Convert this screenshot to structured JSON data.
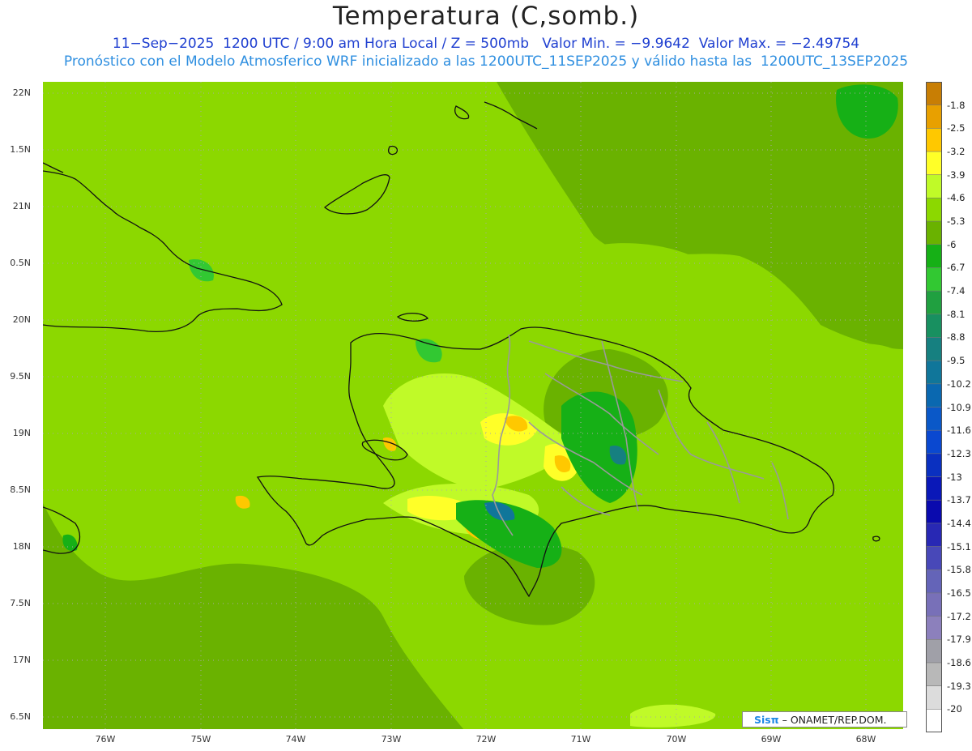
{
  "title": "Temperatura (C,somb.)",
  "subtitle_line1": "11−Sep−2025  1200 UTC / 9:00 am Hora Local / Z = 500mb   Valor Min. = −9.9642  Valor Max. = −2.49754",
  "subtitle_line2": "Pronóstico con el Modelo Atmosferico WRF inicializado a las 1200UTC_11SEP2025 y válido hasta las  1200UTC_13SEP2025",
  "lat_labels": [
    "22N",
    "1.5N",
    "21N",
    "0.5N",
    "20N",
    "9.5N",
    "19N",
    "8.5N",
    "18N",
    "7.5N",
    "17N",
    "6.5N"
  ],
  "lon_labels": [
    "76W",
    "75W",
    "74W",
    "73W",
    "72W",
    "71W",
    "70W",
    "69W",
    "68W"
  ],
  "colorbar": {
    "labels": [
      "-1.8",
      "-2.5",
      "-3.2",
      "-3.9",
      "-4.6",
      "-5.3",
      "-6",
      "-6.7",
      "-7.4",
      "-8.1",
      "-8.8",
      "-9.5",
      "-10.2",
      "-10.9",
      "-11.6",
      "-12.3",
      "-13",
      "-13.7",
      "-14.4",
      "-15.1",
      "-15.8",
      "-16.5",
      "-17.2",
      "-17.9",
      "-18.6",
      "-19.3",
      "-20"
    ],
    "colors": [
      "#c87e04",
      "#e8a000",
      "#ffc800",
      "#ffff28",
      "#c0fa28",
      "#8cd800",
      "#6ab200",
      "#16b016",
      "#32c832",
      "#20a040",
      "#189060",
      "#168080",
      "#10769a",
      "#0a68b0",
      "#0a58c8",
      "#0a48d0",
      "#0a30c0",
      "#0a18b8",
      "#0a0aae",
      "#2828b4",
      "#4848b8",
      "#6464b8",
      "#7870b8",
      "#8c80bc",
      "#a0a0a8",
      "#b8b8b8",
      "#dcdcdc",
      "#ffffff"
    ]
  },
  "credit": {
    "brand": "Sisπ",
    "text": "– ONAMET/REP.DOM."
  }
}
